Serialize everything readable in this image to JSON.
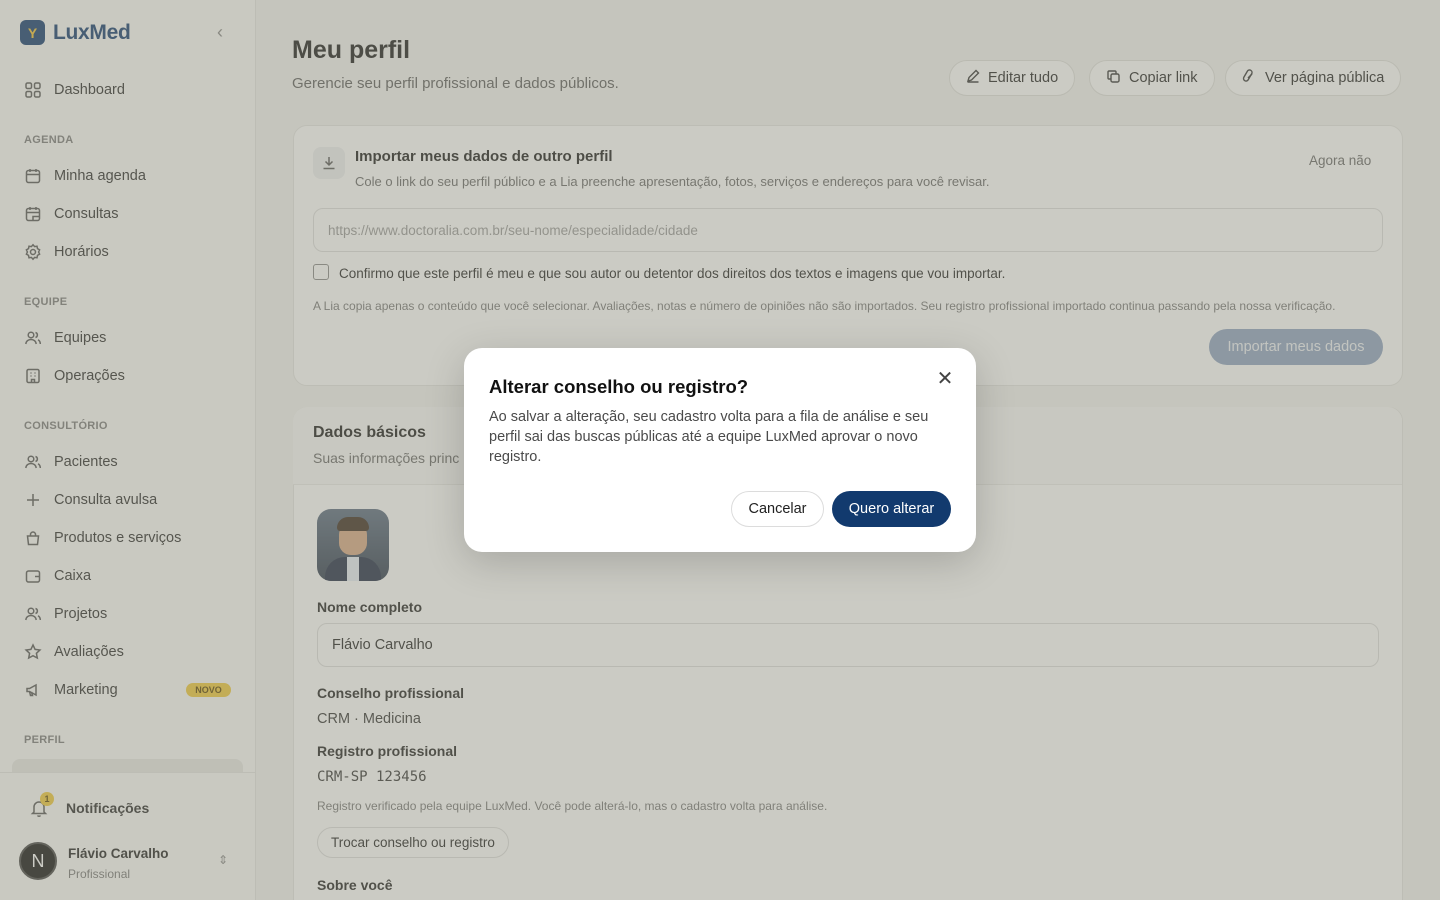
{
  "app": {
    "name": "LuxMed",
    "logo_letter": "Y",
    "brand_color": "#123a6e",
    "accent_color": "#f0c93a"
  },
  "sidebar": {
    "items": [
      {
        "label": "Dashboard",
        "icon": "grid-icon"
      },
      {
        "label": "Minha agenda",
        "icon": "calendar-icon"
      },
      {
        "label": "Consultas",
        "icon": "calendar-check-icon"
      },
      {
        "label": "Horários",
        "icon": "gear-icon"
      },
      {
        "label": "Equipes",
        "icon": "users-icon"
      },
      {
        "label": "Operações",
        "icon": "building-icon"
      },
      {
        "label": "Pacientes",
        "icon": "users-icon"
      },
      {
        "label": "Consulta avulsa",
        "icon": "plus-icon"
      },
      {
        "label": "Produtos e serviços",
        "icon": "bag-icon"
      },
      {
        "label": "Caixa",
        "icon": "wallet-icon"
      },
      {
        "label": "Projetos",
        "icon": "users-icon"
      },
      {
        "label": "Avaliações",
        "icon": "star-icon"
      },
      {
        "label": "Marketing",
        "icon": "megaphone-icon"
      }
    ],
    "sections": {
      "agenda": "AGENDA",
      "equipe": "EQUIPE",
      "consultorio": "CONSULTÓRIO",
      "perfil": "PERFIL"
    },
    "marketing_badge": "NOVO",
    "notifications": {
      "label": "Notificações",
      "count": "1"
    },
    "user": {
      "initial": "N",
      "name": "Flávio Carvalho",
      "role": "Profissional"
    }
  },
  "header": {
    "title": "Meu perfil",
    "subtitle": "Gerencie seu perfil profissional e dados públicos.",
    "actions": {
      "edit": "Editar tudo",
      "copy": "Copiar link",
      "view": "Ver página pública"
    }
  },
  "import_card": {
    "title": "Importar meus dados de outro perfil",
    "description": "Cole o link do seu perfil público e a Lia preenche apresentação, fotos, serviços e endereços para você revisar.",
    "dismiss": "Agora não",
    "url_placeholder": "https://www.doctoralia.com.br/seu-nome/especialidade/cidade",
    "confirm_label": "Confirmo que este perfil é meu e que sou autor ou detentor dos direitos dos textos e imagens que vou importar.",
    "note": "A Lia copia apenas o conteúdo que você selecionar. Avaliações, notas e número de opiniões não são importados. Seu registro profissional importado continua passando pela nossa verificação.",
    "submit": "Importar meus dados"
  },
  "basic_card": {
    "title": "Dados básicos",
    "subtitle": "Suas informações princ",
    "name_label": "Nome completo",
    "name_value": "Flávio Carvalho",
    "council_label": "Conselho profissional",
    "council_value": "CRM · Medicina",
    "registry_label": "Registro profissional",
    "registry_value": "CRM-SP 123456",
    "registry_note": "Registro verificado pela equipe LuxMed. Você pode alterá-lo, mas o cadastro volta para análise.",
    "swap_button": "Trocar conselho ou registro",
    "about_label": "Sobre você"
  },
  "modal": {
    "title": "Alterar conselho ou registro?",
    "body": "Ao salvar a alteração, seu cadastro volta para a fila de análise e seu perfil sai das buscas públicas até a equipe LuxMed aprovar o novo registro.",
    "cancel": "Cancelar",
    "confirm": "Quero alterar"
  }
}
